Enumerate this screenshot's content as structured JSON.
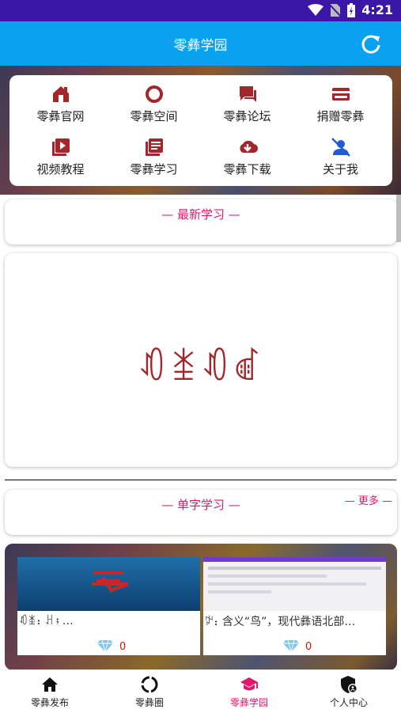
{
  "status_bar": {
    "time": "4:21"
  },
  "app_bar": {
    "title": "零彝学园"
  },
  "menu": [
    {
      "label": "零彝官网",
      "icon": "home-icon"
    },
    {
      "label": "零彝空间",
      "icon": "circle-icon"
    },
    {
      "label": "零彝论坛",
      "icon": "forum-icon"
    },
    {
      "label": "捐赠零彝",
      "icon": "card-icon"
    },
    {
      "label": "视频教程",
      "icon": "video-icon"
    },
    {
      "label": "零彝学习",
      "icon": "book-icon"
    },
    {
      "label": "零彝下载",
      "icon": "download-icon"
    },
    {
      "label": "关于我",
      "icon": "person-icon"
    }
  ],
  "latest": {
    "title": "— 最新学习 —",
    "featured_text": "ꀒꁧꀒꀷ"
  },
  "single": {
    "title": "— 单字学习 —",
    "more": "— 更多 —"
  },
  "tiles": [
    {
      "caption": "ꀒꁧ：ꃅ；…",
      "count": "0"
    },
    {
      "caption": "ꉢ：含义“鸟”，现代彝语北部…",
      "count": "0"
    }
  ],
  "nav": [
    {
      "label": "零彝发布",
      "icon": "home-icon"
    },
    {
      "label": "零彝圈",
      "icon": "ring-icon"
    },
    {
      "label": "零彝学园",
      "icon": "school-icon"
    },
    {
      "label": "个人中心",
      "icon": "shield-user-icon"
    }
  ],
  "colors": {
    "status_bar": "#3b17a8",
    "app_bar": "#0aa2ef",
    "accent": "#e2166a",
    "icon_red": "#a3262b"
  }
}
